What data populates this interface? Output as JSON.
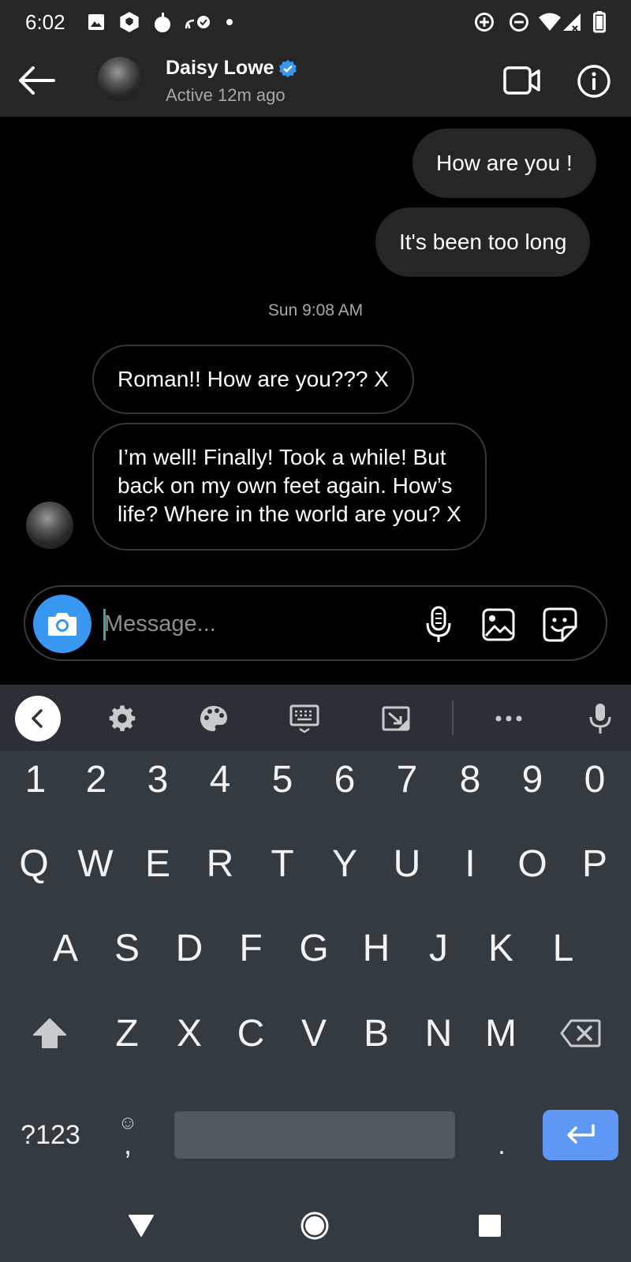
{
  "status_bar": {
    "time": "6:02",
    "icons": [
      "image-icon",
      "shield-hex-icon",
      "fruit-icon",
      "cast-check-icon",
      "dot-icon",
      "data-saver-icon",
      "dnd-icon",
      "wifi-icon",
      "signal-icon",
      "battery-icon"
    ]
  },
  "header": {
    "name": "Daisy Lowe",
    "status": "Active 12m ago",
    "verified_color": "#3897f0"
  },
  "chat": {
    "outgoing": [
      {
        "text": "How are you !"
      },
      {
        "text": "It's been too long"
      }
    ],
    "timestamp": "Sun 9:08 AM",
    "incoming": [
      {
        "text": "Roman!! How are you??? X"
      },
      {
        "lines": [
          "I’m well! Finally! Took a while! But",
          "back on my own feet again. How’s",
          "life? Where in the world are you? X"
        ]
      }
    ]
  },
  "composer": {
    "placeholder": "Message...",
    "accent_color": "#3897f0"
  },
  "keyboard": {
    "number_row": [
      "1",
      "2",
      "3",
      "4",
      "5",
      "6",
      "7",
      "8",
      "9",
      "0"
    ],
    "row1": [
      "Q",
      "W",
      "E",
      "R",
      "T",
      "Y",
      "U",
      "I",
      "O",
      "P"
    ],
    "row2": [
      "A",
      "S",
      "D",
      "F",
      "G",
      "H",
      "J",
      "K",
      "L"
    ],
    "row3": [
      "Z",
      "X",
      "C",
      "V",
      "B",
      "N",
      "M"
    ],
    "symbols_label": "?123",
    "comma_label": ",",
    "emoji_glyph": "☺",
    "period_label": ".",
    "enter_color": "#5e97f6"
  }
}
